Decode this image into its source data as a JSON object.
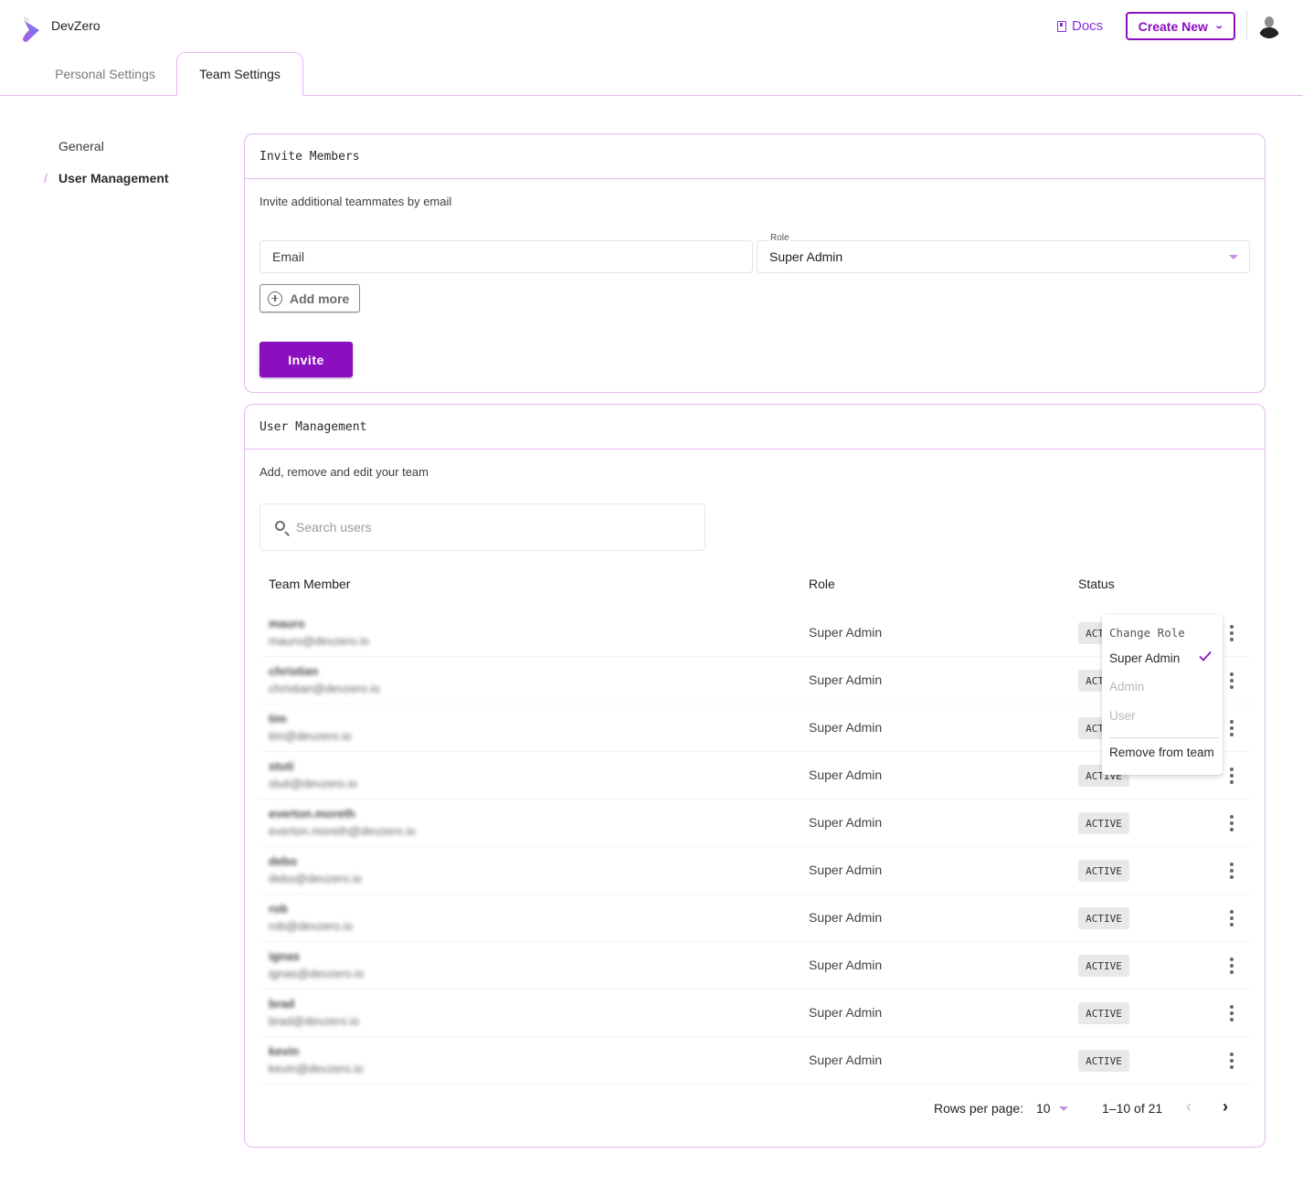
{
  "app": {
    "brand": "DevZero",
    "docs_label": "Docs",
    "create_new_label": "Create New",
    "colors": {
      "accent": "#8a0fbf",
      "border": "#e6b6f2",
      "caret": "#c690e0"
    }
  },
  "tabs": [
    {
      "label": "Personal Settings",
      "active": false
    },
    {
      "label": "Team Settings",
      "active": true
    }
  ],
  "sidebar": {
    "items": [
      {
        "label": "General",
        "active": false
      },
      {
        "label": "User Management",
        "active": true
      }
    ]
  },
  "invite": {
    "title": "Invite Members",
    "description": "Invite additional teammates by email",
    "email_placeholder": "Email",
    "role_label": "Role",
    "role_value": "Super Admin",
    "add_more_label": "Add more",
    "invite_label": "Invite"
  },
  "users": {
    "title": "User Management",
    "description": "Add, remove and edit your team",
    "search_placeholder": "Search users",
    "columns": [
      "Team Member",
      "Role",
      "Status"
    ],
    "rows": [
      {
        "name": "mauro",
        "email": "mauro@devzero.io",
        "role": "Super Admin",
        "status": "ACTIVE"
      },
      {
        "name": "christian",
        "email": "christian@devzero.io",
        "role": "Super Admin",
        "status": "ACTIVE"
      },
      {
        "name": "tim",
        "email": "tim@devzero.io",
        "role": "Super Admin",
        "status": "ACTIVE"
      },
      {
        "name": "stuti",
        "email": "stuti@devzero.io",
        "role": "Super Admin",
        "status": "ACTIVE"
      },
      {
        "name": "everton.moreth",
        "email": "everton.moreth@devzero.io",
        "role": "Super Admin",
        "status": "ACTIVE"
      },
      {
        "name": "debo",
        "email": "debo@devzero.io",
        "role": "Super Admin",
        "status": "ACTIVE"
      },
      {
        "name": "rob",
        "email": "rob@devzero.io",
        "role": "Super Admin",
        "status": "ACTIVE"
      },
      {
        "name": "ignas",
        "email": "ignas@devzero.io",
        "role": "Super Admin",
        "status": "ACTIVE"
      },
      {
        "name": "brad",
        "email": "brad@devzero.io",
        "role": "Super Admin",
        "status": "ACTIVE"
      },
      {
        "name": "kevin",
        "email": "kevin@devzero.io",
        "role": "Super Admin",
        "status": "ACTIVE"
      }
    ],
    "menu": {
      "title": "Change Role",
      "options": [
        {
          "label": "Super Admin",
          "selected": true,
          "enabled": true
        },
        {
          "label": "Admin",
          "selected": false,
          "enabled": false
        },
        {
          "label": "User",
          "selected": false,
          "enabled": false
        }
      ],
      "remove_label": "Remove from team"
    },
    "pagination": {
      "rows_per_page_label": "Rows per page:",
      "rows_per_page": "10",
      "range": "1–10 of 21",
      "prev_enabled": false,
      "next_enabled": true
    }
  }
}
